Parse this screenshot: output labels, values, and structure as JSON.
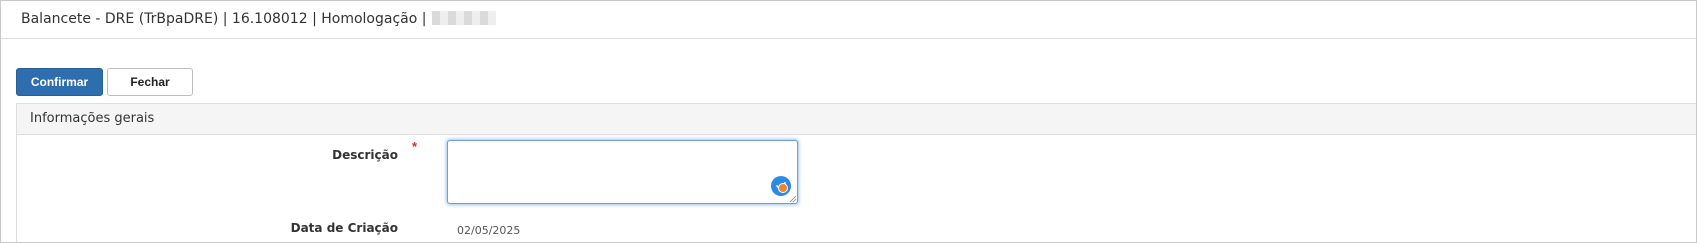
{
  "window": {
    "title": "Balancete - DRE (TrBpaDRE) | 16.108012 | Homologação |"
  },
  "toolbar": {
    "confirm_label": "Confirmar",
    "close_label": "Fechar"
  },
  "panel": {
    "title": "Informações gerais"
  },
  "form": {
    "descricao": {
      "label": "Descrição",
      "required_marker": "*",
      "value": ""
    },
    "data_criacao": {
      "label": "Data de Criação",
      "value": "02/05/2025"
    }
  },
  "icons": {
    "check": "check-circle-icon",
    "status_dot": "status-dot-icon",
    "resize": "resize-handle-icon"
  },
  "colors": {
    "primary": "#2f6eae",
    "focus_border": "#6f9fd6",
    "required": "#d9302c",
    "check_badge": "#2b8ae8",
    "status_dot": "#f2832b"
  }
}
